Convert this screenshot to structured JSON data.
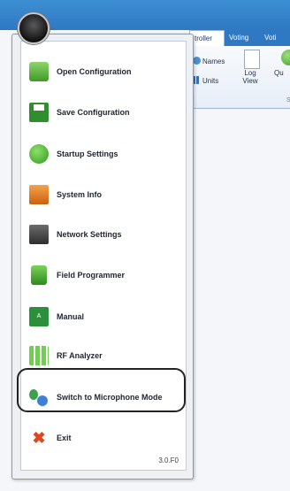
{
  "ribbon": {
    "tabs": [
      "troller",
      "Voting",
      "Voti"
    ],
    "names_label": "Names",
    "units_label": "Units",
    "logview_label": "Log View",
    "quick_label": "Qu",
    "group_label": "S"
  },
  "menu": {
    "items": [
      {
        "label": "Open Configuration",
        "icon": "folder-icon"
      },
      {
        "label": "Save Configuration",
        "icon": "floppy-disk-icon"
      },
      {
        "label": "Startup Settings",
        "icon": "up-arrow-icon"
      },
      {
        "label": "System Info",
        "icon": "system-info-icon"
      },
      {
        "label": "Network Settings",
        "icon": "network-device-icon"
      },
      {
        "label": "Field Programmer",
        "icon": "field-programmer-icon"
      },
      {
        "label": "Manual",
        "icon": "manual-book-icon"
      },
      {
        "label": "RF Analyzer",
        "icon": "rf-analyzer-icon"
      },
      {
        "label": "Switch to Microphone Mode",
        "icon": "people-switch-icon"
      },
      {
        "label": "Exit",
        "icon": "close-x-icon"
      }
    ],
    "manual_icon_text": "A",
    "exit_icon_glyph": "✖",
    "version": "3.0.F0",
    "highlighted_item": "Switch to Microphone Mode"
  },
  "colors": {
    "titlebar": "#3d8fd4",
    "menu_bg": "#ffffff",
    "highlight_border": "#222222",
    "exit_icon": "#e1461c"
  }
}
